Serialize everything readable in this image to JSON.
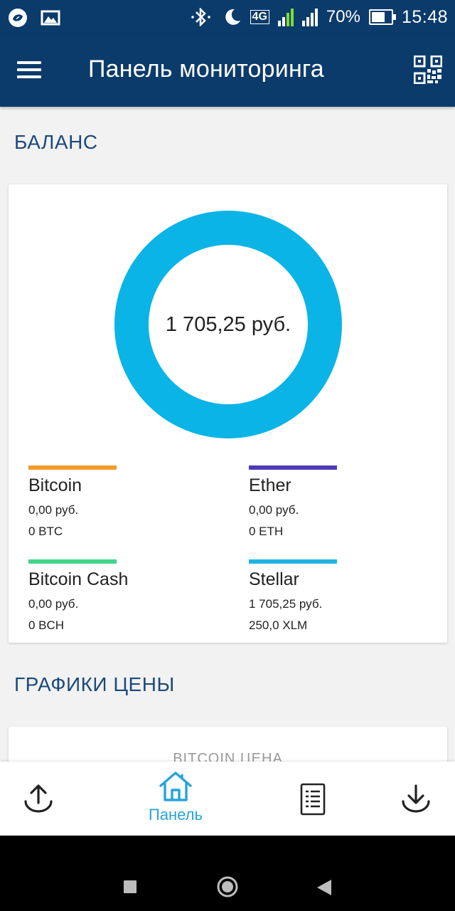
{
  "status_bar": {
    "battery": "70%",
    "time": "15:48",
    "network": "4G",
    "battery_level": 0.7
  },
  "app_bar": {
    "title": "Панель мониторинга",
    "menu_icon": "hamburger-menu-icon",
    "qr_icon": "qr-code-icon"
  },
  "balance": {
    "section_title": "БАЛАНС",
    "total": "1 705,25 руб.",
    "donut_color": "#0ab4e6",
    "assets": [
      {
        "name": "Bitcoin",
        "fiat": "0,00 руб.",
        "amount": "0 BTC",
        "color": "#f39c2b"
      },
      {
        "name": "Ether",
        "fiat": "0,00 руб.",
        "amount": "0 ETH",
        "color": "#4e3ab8"
      },
      {
        "name": "Bitcoin Cash",
        "fiat": "0,00 руб.",
        "amount": "0 BCH",
        "color": "#3fd68a"
      },
      {
        "name": "Stellar",
        "fiat": "1 705,25 руб.",
        "amount": "250,0 XLM",
        "color": "#20b4e2"
      }
    ]
  },
  "price_charts": {
    "section_title": "ГРАФИКИ ЦЕНЫ",
    "card_title": "BITCOIN ЦЕНА"
  },
  "bottom_nav": {
    "items": [
      {
        "icon": "send-upload-icon",
        "label": ""
      },
      {
        "icon": "home-icon",
        "label": "Панель"
      },
      {
        "icon": "transactions-list-icon",
        "label": ""
      },
      {
        "icon": "receive-download-icon",
        "label": ""
      }
    ],
    "active_color": "#26a3dc",
    "inactive_color": "#222222"
  }
}
